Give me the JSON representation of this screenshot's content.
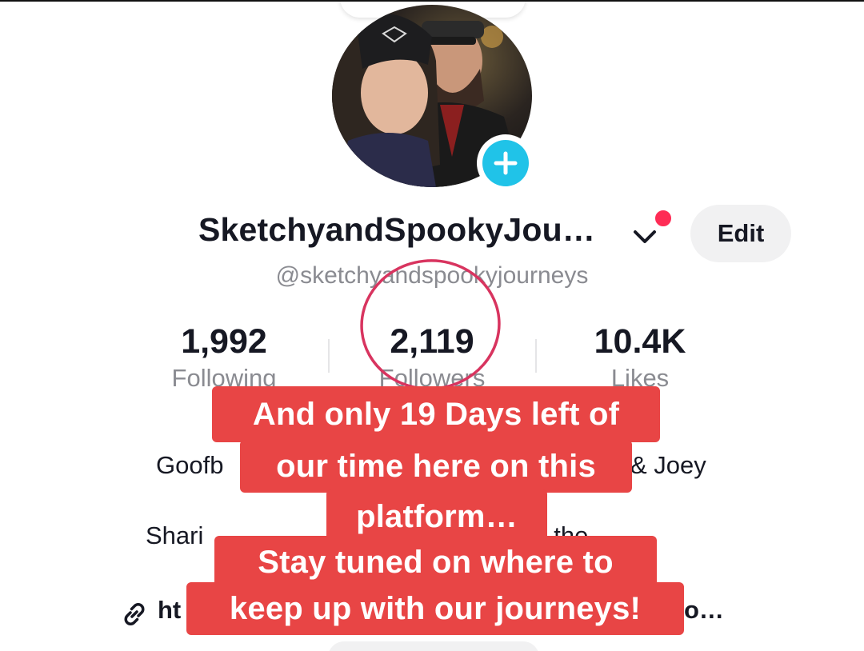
{
  "profile": {
    "display_name": "SketchyandSpookyJou…",
    "username": "@sketchyandspookyjourneys",
    "edit_label": "Edit"
  },
  "stats": {
    "following": {
      "value": "1,992",
      "label": "Following"
    },
    "followers": {
      "value": "2,119",
      "label": "Followers"
    },
    "likes": {
      "value": "10.4K",
      "label": "Likes"
    }
  },
  "bio": {
    "line1_start": "Goofb",
    "line1_end": "& Joey",
    "line2_start": "Shari",
    "line2_end": "f the",
    "link_start": "ht",
    "link_end": "o…"
  },
  "caption": {
    "line1": "And only 19 Days left of",
    "line2": "our time here on this",
    "line3": "platform…",
    "line4": "Stay tuned on where to",
    "line5": "keep up with our journeys!"
  },
  "colors": {
    "caption_bg": "#e84545",
    "add_button": "#20c3e8",
    "notification_dot": "#fe2c55",
    "annotation_circle": "#d8345f"
  },
  "icons": {
    "add": "plus-icon",
    "dropdown": "chevron-down-icon",
    "link": "link-icon"
  }
}
